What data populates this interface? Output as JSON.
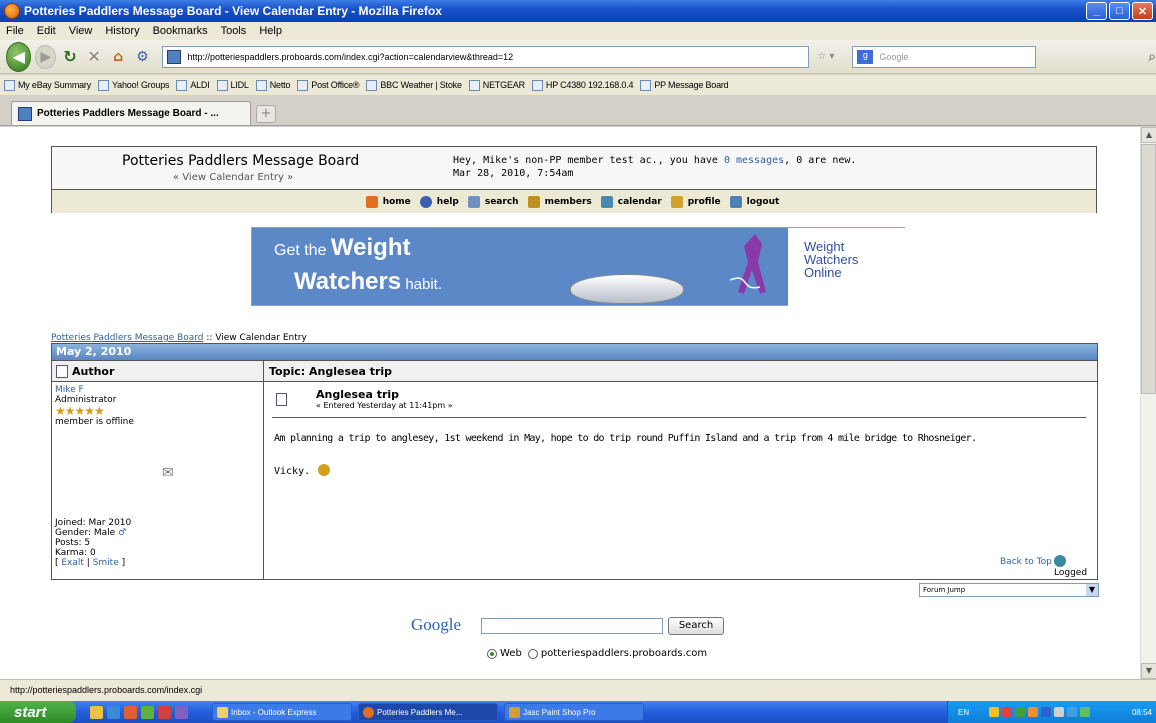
{
  "window": {
    "title": "Potteries Paddlers Message Board - View Calendar Entry - Mozilla Firefox",
    "minimize": "_",
    "maximize": "□",
    "close": "✕"
  },
  "menu": [
    "File",
    "Edit",
    "View",
    "History",
    "Bookmarks",
    "Tools",
    "Help"
  ],
  "nav": {
    "url": "http://potteriespaddlers.proboards.com/index.cgi?action=calendarview&thread=12",
    "search_placeholder": "Google"
  },
  "bookmarks": [
    "My eBay Summary",
    "Yahoo! Groups",
    "ALDI",
    "LIDL",
    "Netto",
    "Post Office®",
    "BBC Weather | Stoke",
    "NETGEAR",
    "HP C4380 192.168.0.4",
    "PP Message Board"
  ],
  "tab": {
    "label": "Potteries Paddlers Message Board - ...",
    "new_tab": "+"
  },
  "board": {
    "title": "Potteries Paddlers Message Board",
    "subtitle": "« View Calendar Entry »",
    "greeting_prefix": "Hey, Mike's non-PP member test ac., you have",
    "messages_link": "0 messages",
    "greeting_suffix": ", 0 are new.",
    "datetime": "Mar 28, 2010, 7:54am",
    "nav_links": [
      "home",
      "help",
      "search",
      "members",
      "calendar",
      "profile",
      "logout"
    ]
  },
  "ad": {
    "line1_prefix": "Get the ",
    "line1_bold": "Weight",
    "line2_bold": "Watchers",
    "line2_suffix": " habit.",
    "logo_line1": "Weight",
    "logo_line2": "Watchers",
    "logo_line3": "Online"
  },
  "breadcrumb": {
    "root": "Potteries Paddlers Message Board",
    "sep": " :: ",
    "current": "View Calendar Entry"
  },
  "entry": {
    "date_header": "May 2, 2010",
    "col_author": "Author",
    "col_topic": "Topic: Anglesea trip",
    "author_name": "Mike F",
    "author_role": "Administrator",
    "stars": "★★★★★",
    "status": "member is offline",
    "joined": "Joined: Mar 2010",
    "gender": "Gender: Male",
    "posts": "Posts: 5",
    "karma": "Karma: 0",
    "exalt": "Exalt",
    "smite": "Smite",
    "post_title": "Anglesea trip",
    "post_entered": "« Entered Yesterday at 11:41pm »",
    "post_text": "Am planning a trip to anglesey, 1st weekend in May, hope to do trip round Puffin Island and a trip from 4 mile bridge to Rhosneiger.",
    "post_signature": "Vicky.",
    "back_to_top": "Back to Top",
    "logged": "Logged"
  },
  "forum_jump": "Forum Jump",
  "google": {
    "logo": "Google",
    "search_button": "Search",
    "option_web": "Web",
    "option_site": "potteriespaddlers.proboards.com"
  },
  "statusbar": "http://potteriespaddlers.proboards.com/index.cgi",
  "taskbar": {
    "start": "start",
    "tasks": [
      "Inbox - Outlook Express",
      "Potteries Paddlers Me...",
      "Jasc Paint Shop Pro"
    ],
    "lang": "EN",
    "clock": "08:54"
  }
}
